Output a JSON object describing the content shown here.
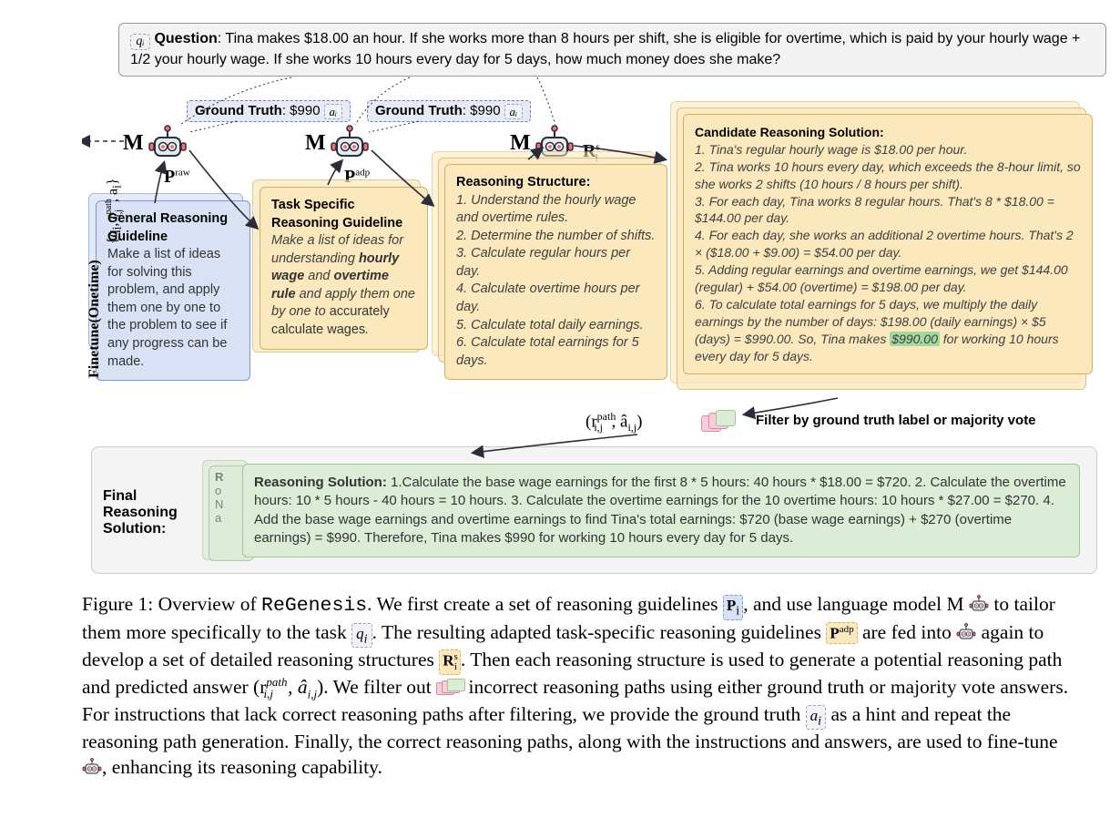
{
  "question": {
    "label": "Question",
    "text": ": Tina makes $18.00 an hour. If she works more than 8 hours per shift, she is eligible for overtime, which is paid by your hourly wage + 1/2 your hourly wage.  If she works 10 hours every day for 5 days, how much money does she make?",
    "qi": "qᵢ"
  },
  "gt": {
    "label": "Ground Truth",
    "value": ": $990",
    "ai": "aᵢ"
  },
  "m_label": "M",
  "p_raw": {
    "sym": "P",
    "sup": "raw"
  },
  "p_adp": {
    "sym": "P",
    "sup": "adp"
  },
  "r_s": {
    "sym": "R",
    "sup": "s",
    "sub": "i"
  },
  "guideline_general": {
    "title": "General Reasoning Guideline",
    "body": "Make a list of ideas for solving this problem, and apply them one by one to the problem to see if any progress can be made."
  },
  "guideline_task": {
    "title": "Task Specific Reasoning Guideline",
    "body1": "Make a list of ideas for understanding ",
    "b1": "hourly wage",
    "mid": " and ",
    "b2": "overtime rule",
    "body2": " and apply them one by one to ",
    "b3": "accurately calculate wages",
    "tail": "."
  },
  "structure": {
    "title": "Reasoning Structure",
    "items": [
      "1. Understand the hourly wage and overtime rules.",
      "2. Determine the number of shifts.",
      "3. Calculate regular hours per day.",
      "4. Calculate overtime hours per day.",
      "5. Calculate total daily earnings.",
      "6. Calculate total earnings for 5 days."
    ]
  },
  "candidate": {
    "title": "Candidate Reasoning Solution:",
    "items": [
      "1. Tina's regular hourly wage is $18.00 per hour.",
      "2. Tina works 10 hours every day, which exceeds the 8-hour limit, so she works 2 shifts (10 hours / 8 hours per shift).",
      "3. For each day, Tina works 8 regular hours. That's 8 * $18.00 = $144.00 per day.",
      "4. For each day, she works an additional 2 overtime hours. That's 2 × ($18.00 + $9.00) = $54.00 per day.",
      "5. Adding regular earnings and overtime earnings, we get $144.00 (regular) + $54.00 (overtime) = $198.00 per day.",
      "6. To calculate total earnings for 5 days, we multiply the daily earnings by the number of days: $198.00 (daily earnings) × $5 (days) = $990.00. So, Tina makes "
    ],
    "highlight": "$990.00",
    "tail": " for working 10 hours every day for 5 days."
  },
  "filter_tuple": "(r_{i,j}^{path}, âᵢ,ⱼ)",
  "filter_label": "Filter by ground truth label or majority vote",
  "final": {
    "label": "Final Reasoning Solution",
    "stub_r": "R",
    "stub_body": "o\nN\na",
    "title": "Reasoning Solution:",
    "body": " 1.Calculate the base wage earnings for the first 8 * 5 hours: 40 hours * $18.00 = $720. 2. Calculate the overtime hours: 10 * 5 hours - 40 hours = 10 hours. 3. Calculate the overtime earnings for the 10 overtime hours: 10 hours * $27.00 = $270. 4. Add the base wage earnings and overtime earnings to find Tina's total earnings: $720 (base wage earnings) + $270 (overtime earnings) = $990. Therefore, Tina makes $990 for working 10 hours every day for 5 days."
  },
  "side": {
    "finetune": "Finetune(Onetime)",
    "math": "{qᵢ, r_{i,j}^{path}, aᵢ}"
  },
  "caption": {
    "fig": "Figure 1: Overview of ",
    "title": "ReGenesis",
    "s1a": ". We first create a set of reasoning guidelines ",
    "pi": "Pᵢ",
    "s1b": ", and use language model M ",
    "s1c": " to tailor them more specifically to the task ",
    "qi": "qᵢ",
    "s1d": ". The resulting adapted task-specific reasoning guidelines ",
    "padp": "Pᵃᵈᵖ",
    "s1e": " are fed into ",
    "s1f": " again to develop a set of detailed reasoning structures ",
    "ri": "Rᵢˢ",
    "s2a": ". Then each reasoning structure is used to generate a potential reasoning path and predicted answer ",
    "tuple": "(r_{i,j}^{path}, âᵢ,ⱼ)",
    "s2b": ". We filter out ",
    "s2c": " incorrect reasoning paths using either ground truth or majority vote answers. For instructions that lack correct reasoning paths after filtering, we provide the ground truth ",
    "ai": "aᵢ",
    "s2d": " as a hint and repeat the reasoning path generation. Finally, the correct reasoning paths, along with the instructions and answers, are used to fine-tune ",
    "s2e": ", enhancing its reasoning capability."
  }
}
